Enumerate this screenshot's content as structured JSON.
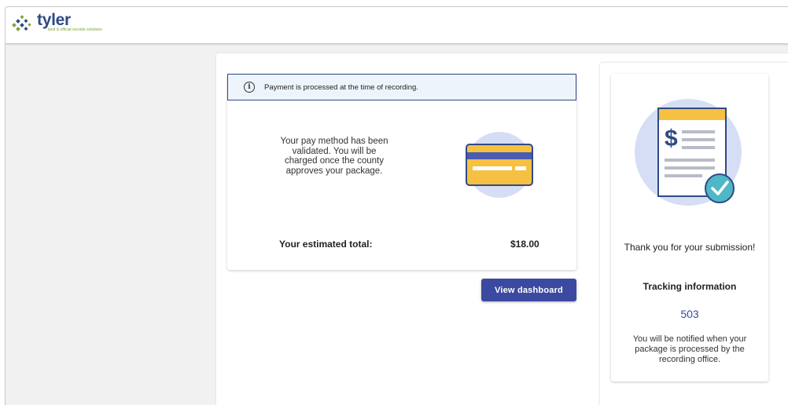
{
  "header": {
    "logo_word": "tyler",
    "logo_tagline": "land & official records solutions"
  },
  "payment": {
    "banner_text": "Payment is processed at the time of recording.",
    "validated_text": "Your pay method has been validated. You will be charged once the county approves your package.",
    "total_label": "Your estimated total:",
    "total_value": "$18.00",
    "dashboard_button": "View dashboard"
  },
  "submission": {
    "thanks_text": "Thank you for your submission!",
    "tracking_label": "Tracking information",
    "tracking_number": "503",
    "notify_text": "You will be notified when your package is processed by the recording office."
  },
  "icons": {
    "logo": "tyler-logo-icon",
    "info": "info-icon",
    "card": "credit-card-icon",
    "document": "invoice-document-icon",
    "check": "check-circle-icon"
  },
  "colors": {
    "primary": "#3b4aa0",
    "brand_blue": "#2f4a86",
    "brand_green": "#7aa33b",
    "accent_yellow": "#f6c142",
    "check_teal": "#4fb7c5",
    "illustration_bg": "#d5def5"
  }
}
